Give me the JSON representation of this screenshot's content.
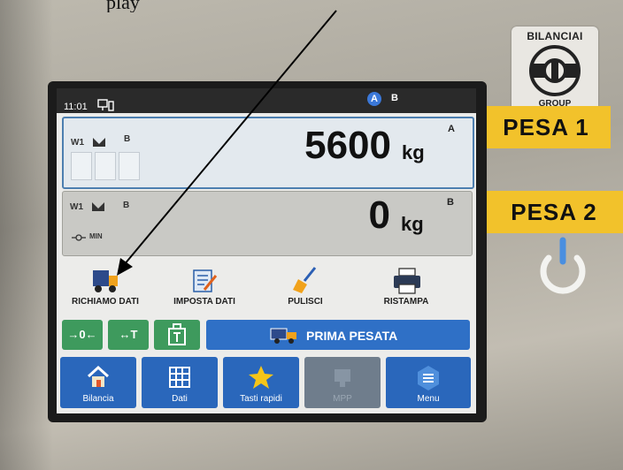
{
  "caption": {
    "text": "play"
  },
  "brand": {
    "name": "BILANCIAI",
    "group": "GROUP"
  },
  "labels": {
    "pesa1": "PESA 1",
    "pesa2": "PESA 2"
  },
  "status_bar": {
    "time": "11:01",
    "channel_active": "A",
    "channel_other": "B"
  },
  "weigh1": {
    "scale": "W1",
    "range": "B",
    "value": "5600",
    "unit": "kg",
    "channel": "A"
  },
  "weigh2": {
    "scale": "W1",
    "range": "B",
    "value": "0",
    "unit": "kg",
    "channel": "B",
    "min_label": "MIN"
  },
  "tools": [
    {
      "label": "RICHIAMO DATI",
      "icon": "truck-icon"
    },
    {
      "label": "IMPOSTA DATI",
      "icon": "edit-document-icon"
    },
    {
      "label": "PULISCI",
      "icon": "broom-icon"
    },
    {
      "label": "RISTAMPA",
      "icon": "printer-icon"
    }
  ],
  "keys": {
    "zero": "→0←",
    "tare": "↔T",
    "prima_pesata": "PRIMA PESATA"
  },
  "nav": [
    {
      "label": "Bilancia",
      "icon": "home-icon",
      "enabled": true
    },
    {
      "label": "Dati",
      "icon": "grid-icon",
      "enabled": true
    },
    {
      "label": "Tasti rapidi",
      "icon": "star-icon",
      "enabled": true
    },
    {
      "label": "MPP",
      "icon": "mpp-icon",
      "enabled": false
    },
    {
      "label": "Menu",
      "icon": "menu-icon",
      "enabled": true
    }
  ],
  "colors": {
    "accent_blue": "#2f70c6",
    "key_green": "#3e9a5d",
    "label_yellow": "#f2c22b",
    "star_yellow": "#f5c518"
  }
}
